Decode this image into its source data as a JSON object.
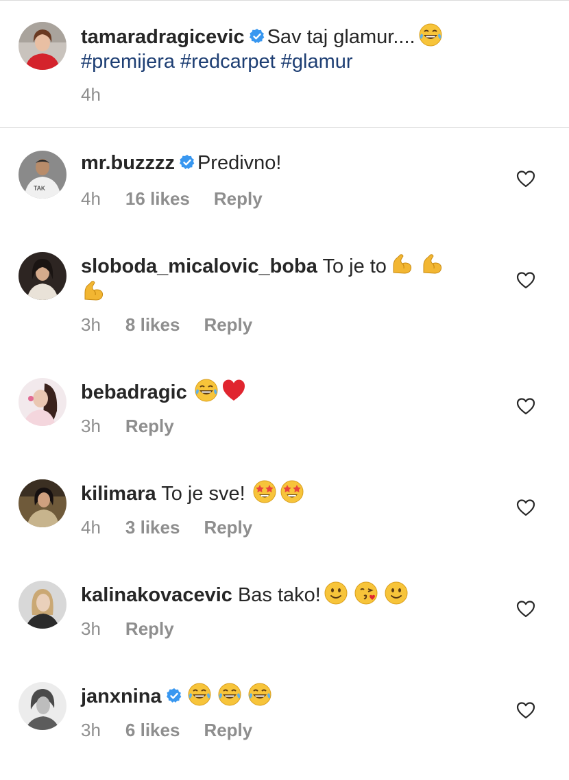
{
  "caption": {
    "username": "tamaradragicevic",
    "text": "Sav taj glamur....",
    "tags": "#premijera #redcarpet #glamur",
    "time": "4h"
  },
  "comments": [
    {
      "username": "mr.buzzzz",
      "verified": true,
      "text": "Predivno!",
      "time": "4h",
      "likes": "16 likes",
      "reply": "Reply"
    },
    {
      "username": "sloboda_micalovic_boba",
      "verified": false,
      "text": "To je to",
      "time": "3h",
      "likes": "8 likes",
      "reply": "Reply"
    },
    {
      "username": "bebadragic",
      "verified": false,
      "text": "",
      "time": "3h",
      "likes": "",
      "reply": "Reply"
    },
    {
      "username": "kilimara",
      "verified": false,
      "text": "To je sve!",
      "time": "4h",
      "likes": "3 likes",
      "reply": "Reply"
    },
    {
      "username": "kalinakovacevic",
      "verified": false,
      "text": "Bas tako!",
      "time": "3h",
      "likes": "",
      "reply": "Reply"
    },
    {
      "username": "janxnina",
      "verified": true,
      "text": "",
      "time": "3h",
      "likes": "6 likes",
      "reply": "Reply"
    }
  ],
  "icons": {
    "verified": "verified-badge-icon",
    "heart": "heart-outline-icon",
    "laugh": "face-with-tears-of-joy-icon",
    "muscle": "flexed-biceps-icon",
    "red_heart": "red-heart-icon",
    "star_eyes": "star-struck-icon",
    "smile": "slightly-smiling-face-icon",
    "kiss": "face-blowing-kiss-icon"
  },
  "colors": {
    "verified": "#3897f0",
    "hashtag": "#1d3e73",
    "meta": "#8e8e8e",
    "text": "#262626"
  }
}
